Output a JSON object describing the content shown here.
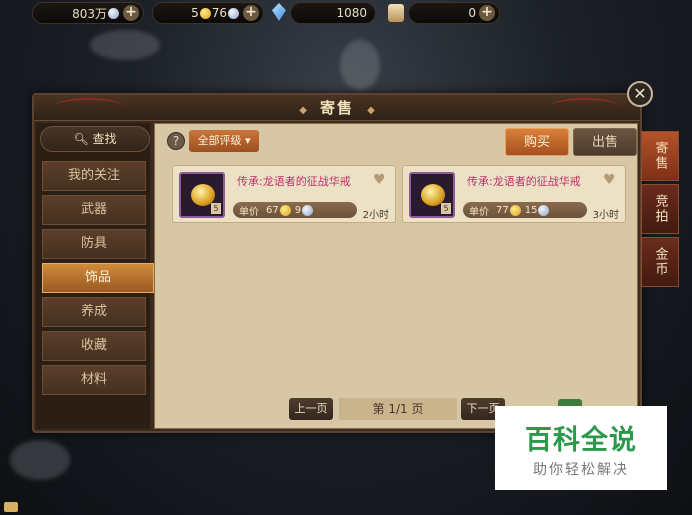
{
  "resources": {
    "r1_value": "803万",
    "r2_gold": "5",
    "r2_silver": "76",
    "gems": "1080",
    "scrolls": "0"
  },
  "panel": {
    "title": "寄售",
    "close_symbol": "✕"
  },
  "sidebar": {
    "search_label": "查找",
    "categories": [
      {
        "label": "我的关注"
      },
      {
        "label": "武器"
      },
      {
        "label": "防具"
      },
      {
        "label": "饰品"
      },
      {
        "label": "养成"
      },
      {
        "label": "收藏"
      },
      {
        "label": "材料"
      }
    ],
    "active_index": 3
  },
  "toolbar": {
    "help_symbol": "?",
    "grade_filter": "全部评级",
    "buy_tab": "购买",
    "sell_tab": "出售"
  },
  "listings": [
    {
      "name": "传承:龙语者的征战华戒",
      "price_label": "单价",
      "price_gold": "67",
      "price_silver": "9",
      "time_left": "2小时",
      "level": "5"
    },
    {
      "name": "传承:龙语者的征战华戒",
      "price_label": "单价",
      "price_gold": "77",
      "price_silver": "15",
      "time_left": "3小时",
      "level": "5"
    }
  ],
  "pager": {
    "prev": "上一页",
    "info": "第 1/1 页",
    "next": "下一页"
  },
  "right_tabs": [
    {
      "label": "寄售"
    },
    {
      "label": "竞拍"
    },
    {
      "label": "金币"
    }
  ],
  "watermark": {
    "title": "百科全说",
    "subtitle": "助你轻松解决"
  },
  "colors": {
    "accent": "#c9763c",
    "item_name": "#c0306b",
    "panel_bg": "#3b2a1e"
  }
}
